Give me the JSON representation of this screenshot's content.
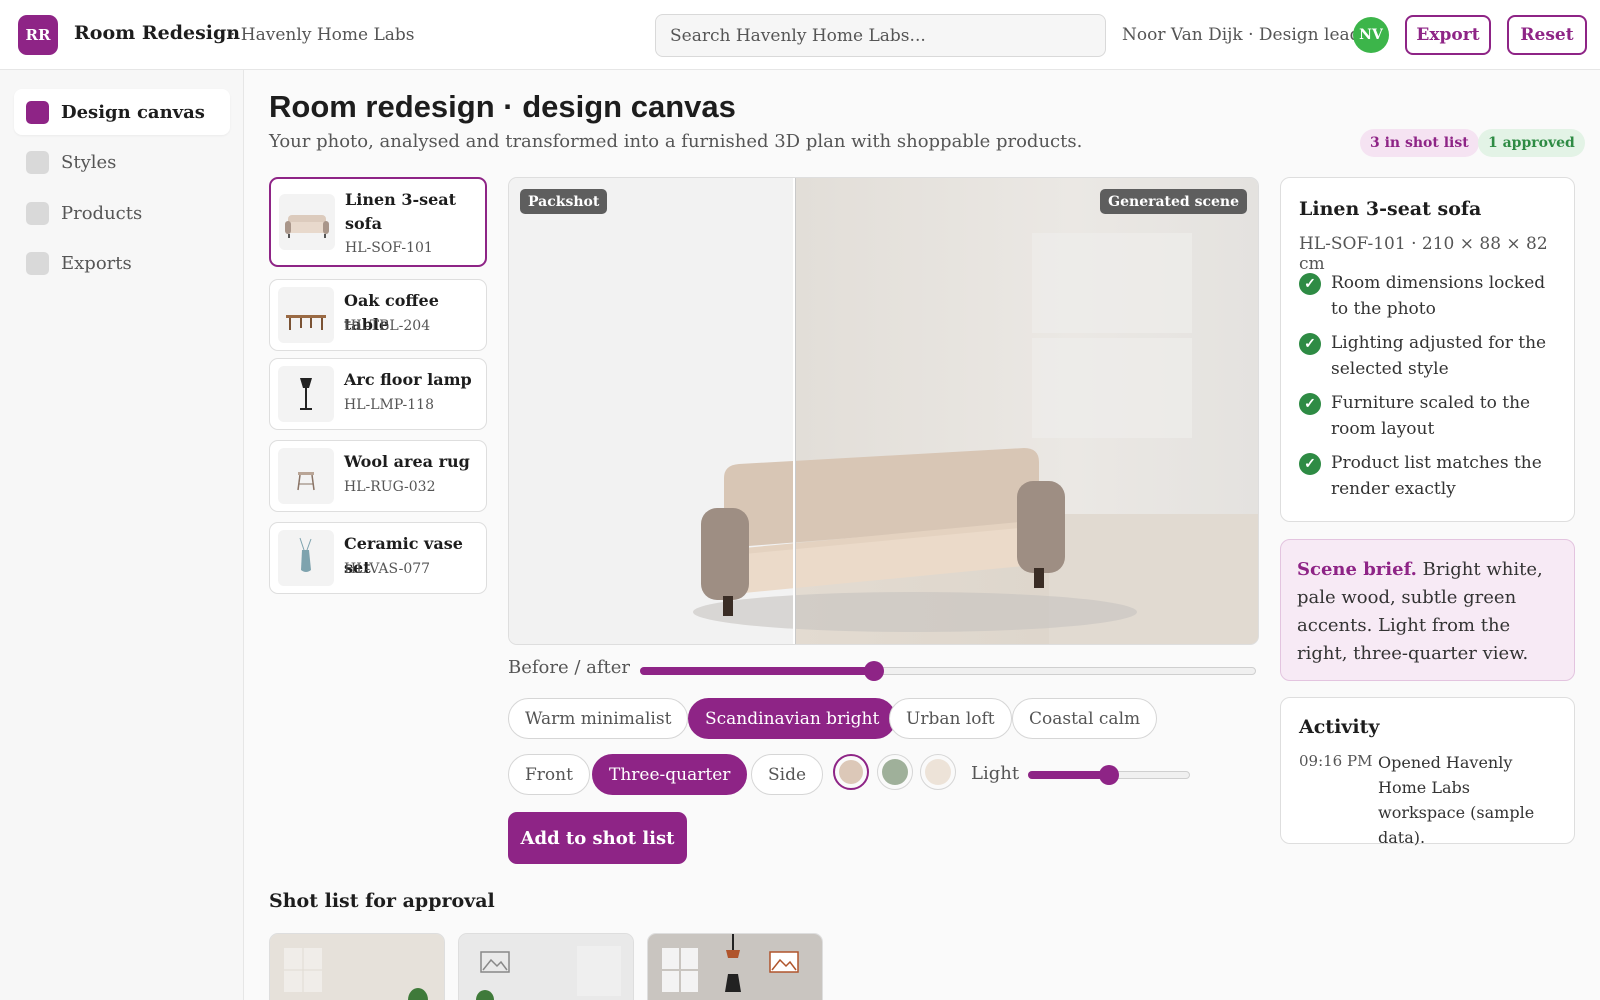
{
  "app": {
    "logo_text": "RR",
    "title": "Room Redesign",
    "workspace": "· Havenly Home Labs"
  },
  "header": {
    "search_placeholder": "Search Havenly Home Labs...",
    "user_label": "Noor Van Dijk · Design lead",
    "avatar_initials": "NV",
    "export_label": "Export",
    "reset_label": "Reset"
  },
  "sidebar": {
    "items": [
      {
        "label": "Design canvas",
        "active": true
      },
      {
        "label": "Styles",
        "active": false
      },
      {
        "label": "Products",
        "active": false
      },
      {
        "label": "Exports",
        "active": false
      }
    ]
  },
  "page": {
    "title": "Room redesign · design canvas",
    "subtitle": "Your photo, analysed and transformed into a furnished 3D plan with shoppable products.",
    "badges": {
      "shot_list": "3 in shot list",
      "approved": "1 approved"
    }
  },
  "products": [
    {
      "name": "Linen 3-seat sofa",
      "sku": "HL-SOF-101",
      "selected": true,
      "icon": "sofa-icon"
    },
    {
      "name": "Oak coffee table",
      "sku": "HL-TBL-204",
      "selected": false,
      "icon": "table-icon"
    },
    {
      "name": "Arc floor lamp",
      "sku": "HL-LMP-118",
      "selected": false,
      "icon": "lamp-icon"
    },
    {
      "name": "Wool area rug",
      "sku": "HL-RUG-032",
      "selected": false,
      "icon": "stool-icon"
    },
    {
      "name": "Ceramic vase set",
      "sku": "HL-VAS-077",
      "selected": false,
      "icon": "vase-icon"
    }
  ],
  "canvas": {
    "left_tag": "Packshot",
    "right_tag": "Generated scene",
    "before_after_label": "Before / after",
    "before_after_value": 0.38
  },
  "styles": {
    "options": [
      "Warm minimalist",
      "Scandinavian bright",
      "Urban loft",
      "Coastal calm"
    ],
    "selected": "Scandinavian bright"
  },
  "views": {
    "options": [
      "Front",
      "Three-quarter",
      "Side"
    ],
    "selected": "Three-quarter"
  },
  "swatches": [
    {
      "color": "#dcc8b8",
      "selected": true
    },
    {
      "color": "#9fb09a",
      "selected": false
    },
    {
      "color": "#ede3d8",
      "selected": false
    }
  ],
  "light": {
    "label": "Light",
    "value": 0.5
  },
  "actions": {
    "add_to_shot_list": "Add to shot list"
  },
  "shot_list": {
    "title": "Shot list for approval"
  },
  "selected_product": {
    "name": "Linen 3-seat sofa",
    "meta": "HL-SOF-101 · 210 × 88 × 82 cm",
    "checks": [
      "Room dimensions locked to the photo",
      "Lighting adjusted for the selected style",
      "Furniture scaled to the room layout",
      "Product list matches the render exactly"
    ]
  },
  "brief": {
    "label": "Scene brief.",
    "text": " Bright white, pale wood, subtle green accents. Light from the right, three-quarter view."
  },
  "activity": {
    "title": "Activity",
    "entries": [
      {
        "time": "09:16 PM",
        "text": "Opened Havenly Home Labs workspace (sample data)."
      }
    ]
  },
  "colors": {
    "accent": "#8e2486",
    "success": "#2e8b44",
    "avatar": "#3cb54a"
  }
}
